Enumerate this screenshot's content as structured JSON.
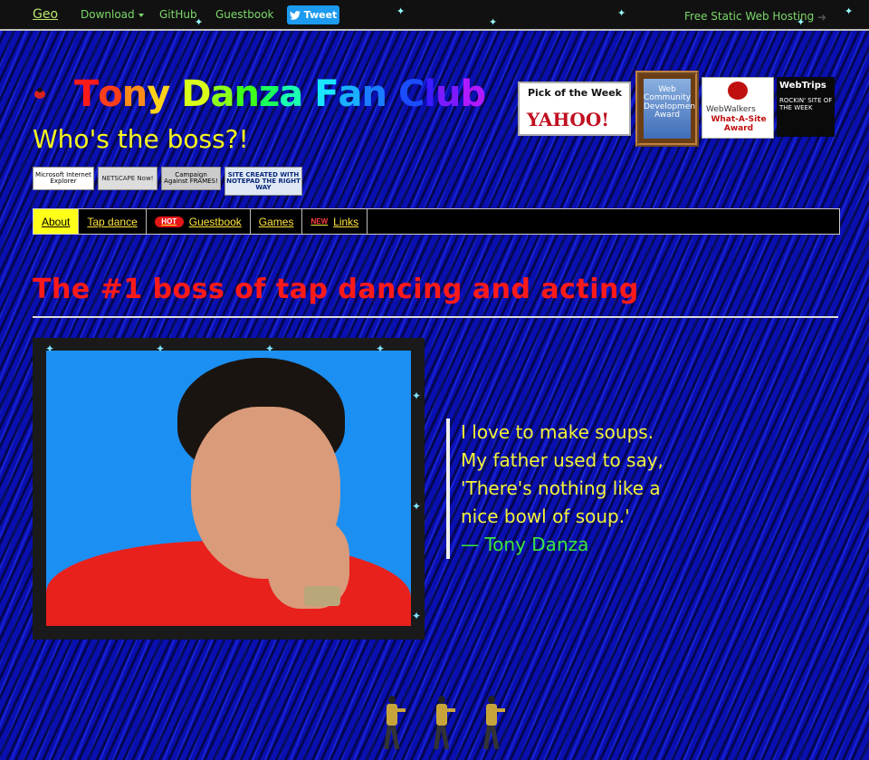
{
  "topbar": {
    "geo": "Geo",
    "download": "Download",
    "github": "GitHub",
    "guestbook": "Guestbook",
    "tweet": "Tweet",
    "hosting": "Free Static Web Hosting"
  },
  "header": {
    "title_letters": [
      "T",
      "o",
      "n",
      "y",
      " ",
      "D",
      "a",
      "n",
      "z",
      "a",
      " ",
      "F",
      "a",
      "n",
      " ",
      "C",
      "l",
      "u",
      "b"
    ],
    "title_colors": [
      "#ff1a1a",
      "#ff3d1a",
      "#ff8c1a",
      "#ffd21a",
      "#ffffff",
      "#d8ff1a",
      "#8cff1a",
      "#3dff1a",
      "#1aff5c",
      "#1affb0",
      "#ffffff",
      "#1ae6ff",
      "#1ab0ff",
      "#1a7dff",
      "#ffffff",
      "#1a4dff",
      "#3d1aff",
      "#7d1aff",
      "#b01aff"
    ],
    "tagline": "Who's the boss?!"
  },
  "badges": {
    "ie": "Microsoft Internet Explorer",
    "netscape": "NETSCAPE Now!",
    "frames": "Campaign Against FRAMES!",
    "notepad": "SITE CREATED WITH NOTEPAD THE RIGHT WAY"
  },
  "awards": {
    "yahoo_pick": "Pick of the Week",
    "yahoo": "YAHOO!",
    "webcommunity": "Web Community Development Award",
    "webwalkers": "WebWalkers",
    "whatasite": "What-A-Site Award",
    "webtrips": "WebTrips",
    "webtrips_sub": "ROCKIN' SITE OF THE WEEK"
  },
  "nav": {
    "about": "About",
    "tapdance": "Tap dance",
    "hot": "HOT",
    "guestbook": "Guestbook",
    "games": "Games",
    "new": "NEW",
    "links": "Links"
  },
  "main": {
    "heading": "The #1 boss of tap dancing and acting",
    "quote": "I love to make soups.\nMy father used to say,\n'There's nothing like a\nnice bowl of soup.'",
    "cite": "— Tony Danza"
  },
  "colors": {
    "accent_yellow": "#f2f23a",
    "heading_red": "#ff1a1a",
    "nav_active": "#ffff1a",
    "topbar_green": "#7cd96a",
    "background_blue": "#0a0fb0"
  }
}
